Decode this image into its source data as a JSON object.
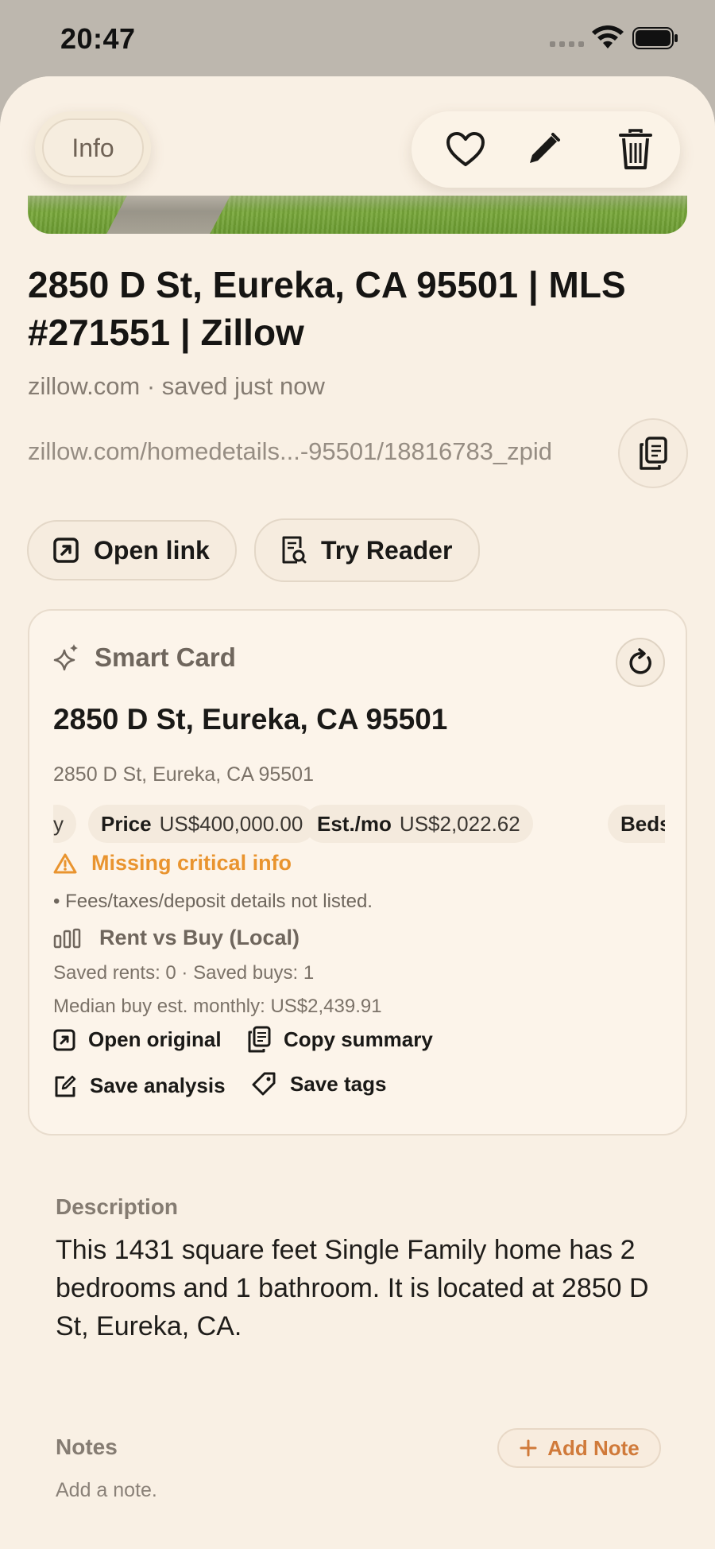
{
  "status_bar": {
    "time": "20:47"
  },
  "header": {
    "info_label": "Info",
    "icons": {
      "favorite": "heart-icon",
      "edit": "pencil-icon",
      "delete": "trash-icon"
    }
  },
  "listing": {
    "title": "2850 D St, Eureka, CA 95501 | MLS #271551 | Zillow",
    "subtitle": "zillow.com · saved just now",
    "url": "zillow.com/homedetails...-95501/18816783_zpid"
  },
  "actions": {
    "open_link": "Open link",
    "try_reader": "Try Reader"
  },
  "smart_card": {
    "header": "Smart Card",
    "title": "2850 D St, Eureka, CA 95501",
    "address": "2850 D St, Eureka, CA 95501",
    "chips": [
      {
        "label": "",
        "value": "y"
      },
      {
        "label": "Price",
        "value": "US$400,000.00"
      },
      {
        "label": "Est./mo",
        "value": "US$2,022.62"
      },
      {
        "label": "Beds",
        "value": ""
      }
    ],
    "warning_title": "Missing critical info",
    "warning_detail": "• Fees/taxes/deposit details not listed.",
    "rent_vs_buy": {
      "title": "Rent vs Buy (Local)",
      "saved_counts": "Saved rents: 0 · Saved buys: 1",
      "median": "Median buy est. monthly: US$2,439.91"
    },
    "buttons": {
      "open_original": "Open original",
      "copy_summary": "Copy summary",
      "save_analysis": "Save analysis",
      "save_tags": "Save tags"
    }
  },
  "description": {
    "label": "Description",
    "text": "This 1431 square feet Single Family home has 2 bedrooms and 1 bathroom. It is located at 2850 D St, Eureka, CA."
  },
  "notes": {
    "label": "Notes",
    "add_button": "Add Note",
    "placeholder": "Add a note."
  },
  "colors": {
    "accent": "#d07a3a",
    "warning": "#e9942f",
    "background": "#f9f0e4"
  }
}
